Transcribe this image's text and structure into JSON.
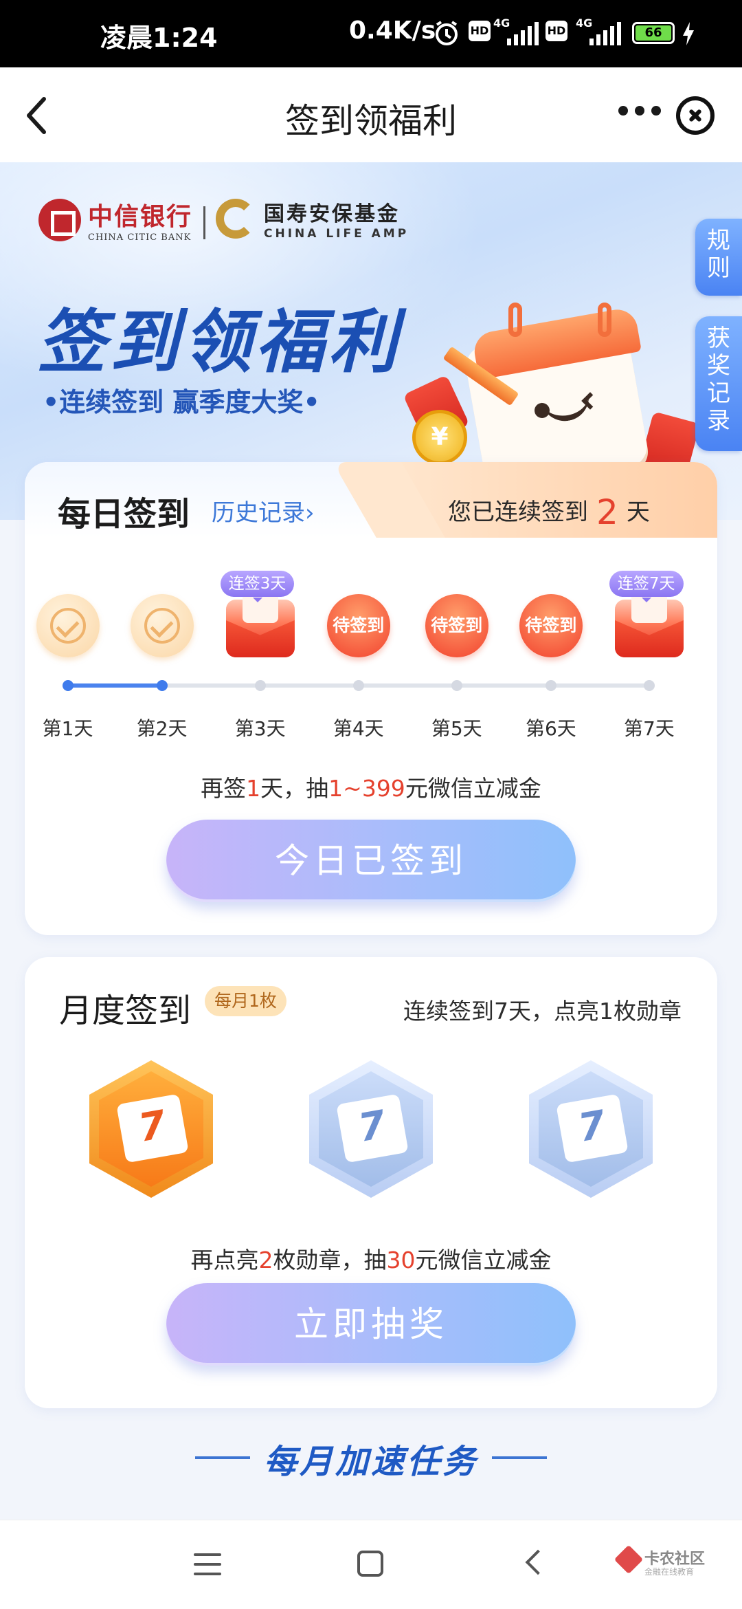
{
  "status_bar": {
    "time": "凌晨1:24",
    "speed": "0.4K/s",
    "hd_label": "HD",
    "network_label": "4G",
    "battery": "66"
  },
  "nav": {
    "title": "签到领福利"
  },
  "hero": {
    "bank_name_cn": "中信银行",
    "bank_name_en": "CHINA CITIC BANK",
    "partner_name_cn": "国寿安保基金",
    "partner_name_en": "CHINA LIFE AMP",
    "title": "签到领福利",
    "subtitle": "•连续签到 赢季度大奖•",
    "coin_symbol": "¥"
  },
  "side_tabs": {
    "rules": "规则",
    "records": "获奖记录"
  },
  "daily": {
    "title": "每日签到",
    "history_link": "历史记录›",
    "streak_prefix": "您已连续签到",
    "streak_days": "2",
    "streak_suffix": "天",
    "days": [
      {
        "label": "第1天",
        "state": "done"
      },
      {
        "label": "第2天",
        "state": "done"
      },
      {
        "label": "第3天",
        "state": "gift",
        "tag": "连签3天"
      },
      {
        "label": "第4天",
        "state": "todo",
        "text": "待签到"
      },
      {
        "label": "第5天",
        "state": "todo",
        "text": "待签到"
      },
      {
        "label": "第6天",
        "state": "todo",
        "text": "待签到"
      },
      {
        "label": "第7天",
        "state": "gift",
        "tag": "连签7天"
      }
    ],
    "tip_prefix": "再签",
    "tip_days": "1",
    "tip_mid": "天，抽",
    "tip_amount": "1~399",
    "tip_suffix": "元微信立减金",
    "button_label": "今日已签到"
  },
  "monthly": {
    "title": "月度签到",
    "badge": "每月1枚",
    "description": "连续签到7天，点亮1枚勋章",
    "medals": [
      {
        "state": "lit",
        "number": "7"
      },
      {
        "state": "unlit",
        "number": "7"
      },
      {
        "state": "unlit",
        "number": "7"
      }
    ],
    "tip_prefix": "再点亮",
    "tip_count": "2",
    "tip_mid": "枚勋章，抽",
    "tip_amount": "30",
    "tip_suffix": "元微信立减金",
    "button_label": "立即抽奖"
  },
  "accelerate": {
    "title": "每月加速任务"
  },
  "watermark": {
    "title": "卡农社区",
    "subtitle": "金融在线教育"
  },
  "colors": {
    "accent_blue": "#1b4fb3",
    "highlight_red": "#e5412d",
    "link_blue": "#3d78d8"
  }
}
